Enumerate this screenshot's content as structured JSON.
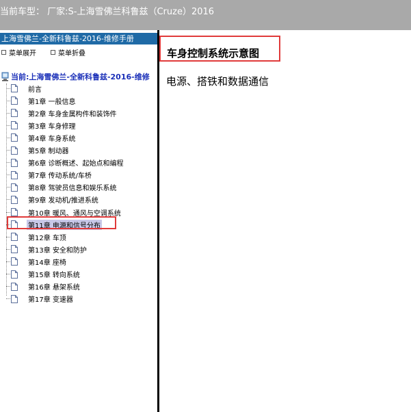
{
  "header": {
    "title": "当前车型：  厂家:S-上海雪佛兰科鲁兹（Cruze）2016"
  },
  "left_panel": {
    "title": "上海雪佛兰-全新科鲁兹-2016-维修手册",
    "expand_label": "菜单展开",
    "collapse_label": "菜单折叠",
    "root_label": "当前:上海雪佛兰-全新科鲁兹-2016-维修",
    "items": [
      {
        "label": "前言"
      },
      {
        "label": "第1章 一般信息"
      },
      {
        "label": "第2章 车身金属构件和装饰件"
      },
      {
        "label": "第3章 车身修理"
      },
      {
        "label": "第4章 车身系统"
      },
      {
        "label": "第5章 制动器"
      },
      {
        "label": "第6章 诊断概述、起始点和编程"
      },
      {
        "label": "第7章 传动系统/车桥"
      },
      {
        "label": "第8章 驾驶员信息和娱乐系统"
      },
      {
        "label": "第9章 发动机/推进系统"
      },
      {
        "label": "第10章 暖风、通风与空调系统"
      },
      {
        "label": "第11章 电源和信号分布"
      },
      {
        "label": "第12章 车顶"
      },
      {
        "label": "第13章 安全和防护"
      },
      {
        "label": "第14章 座椅"
      },
      {
        "label": "第15章 转向系统"
      },
      {
        "label": "第16章 悬架系统"
      },
      {
        "label": "第17章 变速器"
      }
    ],
    "selected_index": 11
  },
  "right_panel": {
    "title": "车身控制系统示意图",
    "subtitle": "电源、搭铁和数据通信"
  },
  "colors": {
    "header_bg": "#a9a9a9",
    "panel_header_bg": "#1f6aa6",
    "root_text": "#1a2fb8",
    "highlight_box": "#e03a3a",
    "selection_bg": "#c8c8e8"
  }
}
